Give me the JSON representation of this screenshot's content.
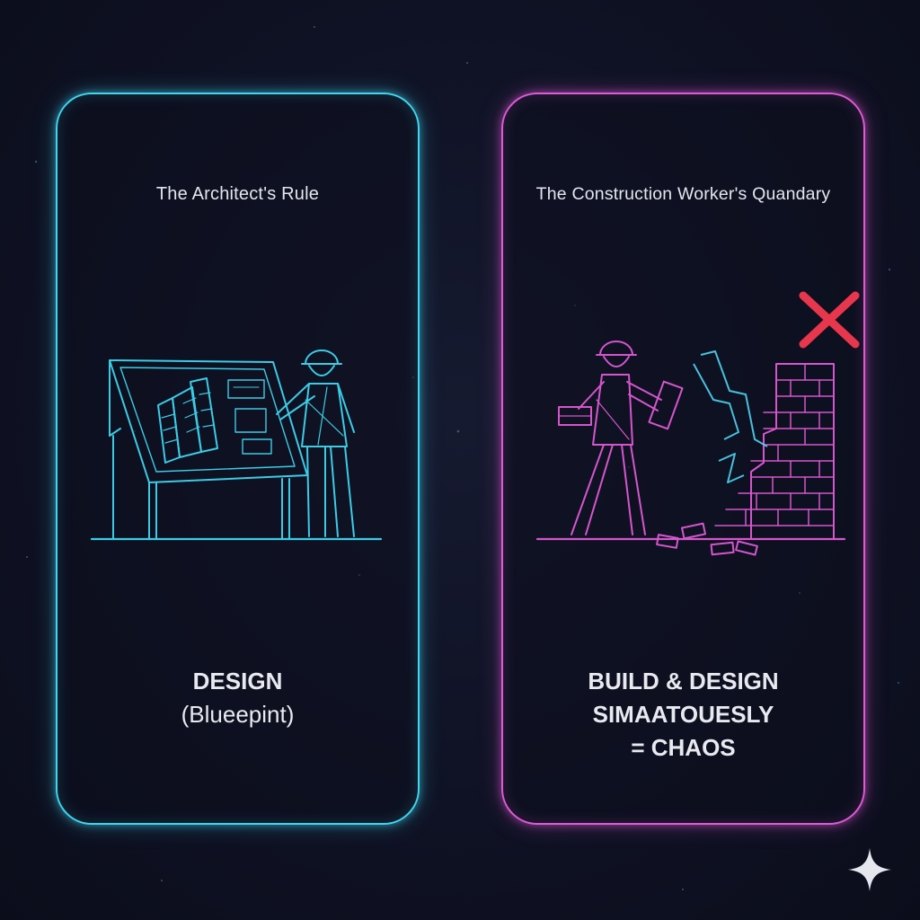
{
  "panels": [
    {
      "title": "The Architect's Rule",
      "caption_lines": [
        "DESIGN",
        "(Blueepint)"
      ],
      "color": "#3fd6f0"
    },
    {
      "title": "The Construction Worker's Quandary",
      "caption_lines": [
        "BUILD & DESIGN",
        "SIMAATOUESLY",
        "= CHAOS"
      ],
      "color": "#e05ad6",
      "mark_color": "#e8364d"
    }
  ],
  "icons": [
    "architect-drafting-icon",
    "worker-brick-wall-icon",
    "red-x-icon",
    "sparkle-icon"
  ]
}
